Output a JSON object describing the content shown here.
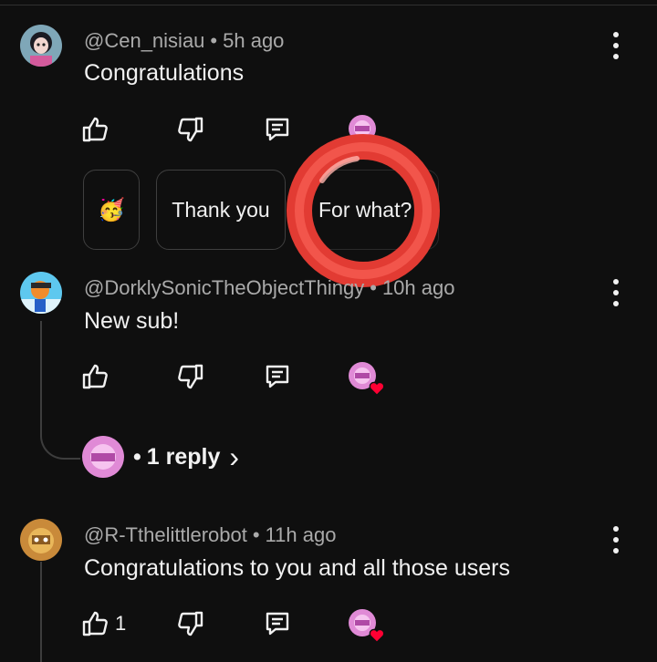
{
  "comments": [
    {
      "author": "@Cen_nisiau",
      "separator": "•",
      "time": "5h ago",
      "text": "Congratulations",
      "like_count": ""
    },
    {
      "author": "@DorklySonicTheObjectThingy",
      "separator": "•",
      "time": "10h ago",
      "text": "New sub!",
      "like_count": ""
    },
    {
      "author": "@R-Tthelittlerobot",
      "separator": "•",
      "time": "11h ago",
      "text": "Congratulations to you and all those users",
      "like_count": "1"
    }
  ],
  "quick_replies": [
    {
      "label": "🥳"
    },
    {
      "label": "Thank you"
    },
    {
      "label": "For what?"
    }
  ],
  "reply_summary": {
    "bullet": "•",
    "label": "1 reply",
    "chevron": "›"
  },
  "icons": {
    "like": "thumbs-up-icon",
    "dislike": "thumbs-down-icon",
    "reply": "reply-comment-icon",
    "creator_heart": "creator-heart-icon",
    "more": "more-vertical-icon"
  },
  "colors": {
    "background": "#0f0f0f",
    "text": "#f1f1f1",
    "meta": "#aaaaaa",
    "highlight_ring": "#e23b33",
    "heart": "#ff0033"
  }
}
